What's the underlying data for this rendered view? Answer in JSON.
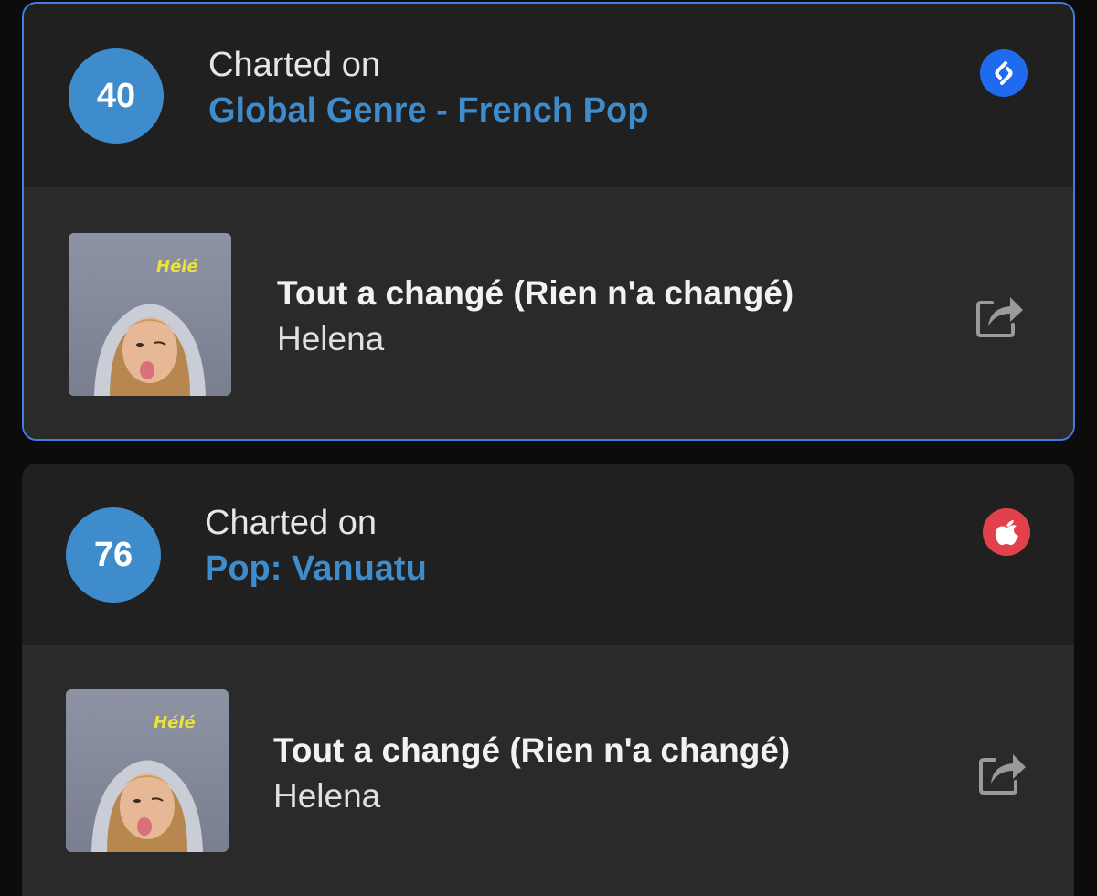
{
  "cards": [
    {
      "rank": "40",
      "charted_label": "Charted on",
      "chart_name": "Global Genre - French Pop",
      "service_icon": "shazam-icon",
      "track": {
        "title": "Tout a changé (Rien n'a changé)",
        "artist": "Helena",
        "cover_text": "Hélé"
      }
    },
    {
      "rank": "76",
      "charted_label": "Charted on",
      "chart_name": "Pop: Vanuatu",
      "service_icon": "apple-music-icon",
      "track": {
        "title": "Tout a changé (Rien n'a changé)",
        "artist": "Helena",
        "cover_text": "Hélé"
      }
    }
  ],
  "colors": {
    "accent": "#3e8ccb",
    "selection_border": "#3f7ee0",
    "shazam": "#1f6bf0",
    "apple": "#e2414b",
    "card_header": "#202021",
    "card_body": "#2a2a2b",
    "background": "#0c0c0d"
  }
}
